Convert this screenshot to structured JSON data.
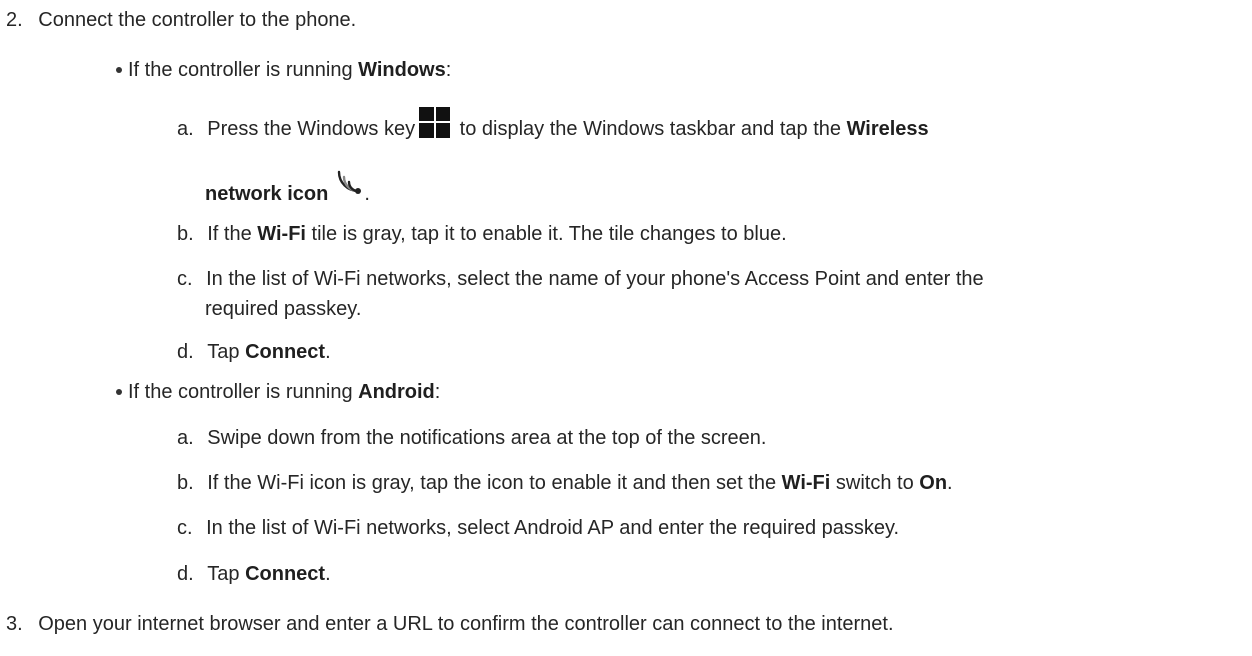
{
  "steps": {
    "step2": {
      "number": "2.",
      "text": "Connect the controller to the phone."
    },
    "windows": {
      "intro": "If the controller is running ",
      "os": "Windows",
      "colon": ":",
      "a": {
        "letter": "a.",
        "t1": "Press the Windows key",
        "t2": " to display the Windows taskbar and tap the ",
        "b1": "Wireless",
        "b2": "network icon",
        "t3": "."
      },
      "b": {
        "letter": "b.",
        "t1": "If the ",
        "b1": "Wi-Fi",
        "t2": " tile is gray, tap it to enable it. The tile changes to blue."
      },
      "c": {
        "letter": "c.",
        "line1": "In the list of Wi-Fi networks, select the name of your phone's Access Point and enter the",
        "line2": "required passkey."
      },
      "d": {
        "letter": "d.",
        "t1": "Tap ",
        "b1": "Connect",
        "t2": "."
      }
    },
    "android": {
      "intro": "If the controller is running ",
      "os": "Android",
      "colon": ":",
      "a": {
        "letter": "a.",
        "text": "Swipe down from the notifications area at the top of the screen."
      },
      "b": {
        "letter": "b.",
        "t1": "If the Wi-Fi icon is gray, tap the icon to enable it and then set the ",
        "b1": "Wi-Fi",
        "t2": " switch to ",
        "b2": "On",
        "t3": "."
      },
      "c": {
        "letter": "c.",
        "text": "In the list of Wi-Fi networks, select Android AP and enter the required passkey."
      },
      "d": {
        "letter": "d.",
        "t1": "Tap ",
        "b1": "Connect",
        "t2": "."
      }
    },
    "step3": {
      "number": "3.",
      "text": "Open your internet browser and enter a URL to confirm the controller can connect to the internet."
    }
  },
  "icons": [
    "windows-logo-icon",
    "wireless-network-icon"
  ]
}
